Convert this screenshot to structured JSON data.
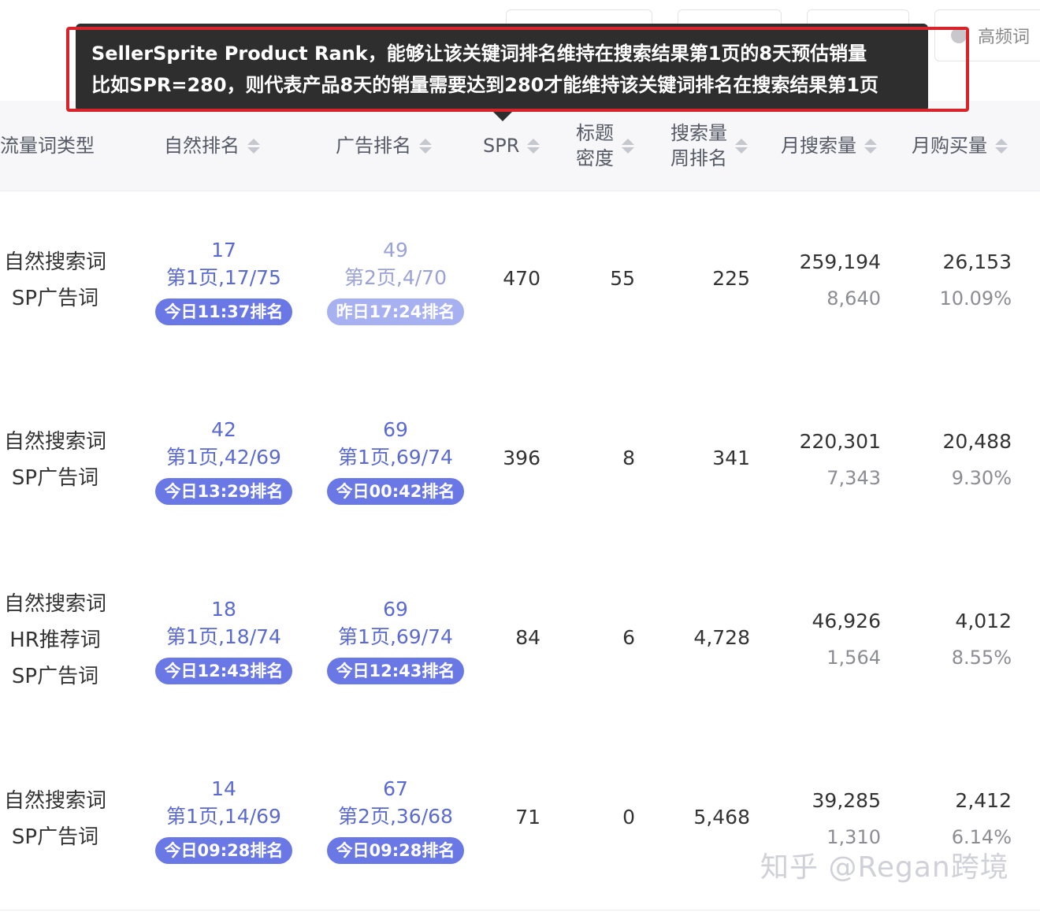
{
  "toolbar": {
    "buttons": [
      "",
      "",
      "",
      "高频词"
    ]
  },
  "tooltip": {
    "line1": "SellerSprite Product Rank，能够让该关键词排名维持在搜索结果第1页的8天预估销量",
    "line2": "比如SPR=280，则代表产品8天的销量需要达到280才能维持该关键词排名在搜索结果第1页"
  },
  "table": {
    "headers": {
      "traffic_type": "流量词类型",
      "natural_rank": "自然排名",
      "ad_rank": "广告排名",
      "spr": "SPR",
      "title_density_l1": "标题",
      "title_density_l2": "密度",
      "search_week_rank_l1": "搜索量",
      "search_week_rank_l2": "周排名",
      "monthly_search": "月搜索量",
      "monthly_purchase": "月购买量"
    },
    "rows": [
      {
        "types": [
          "自然搜索词",
          "SP广告词"
        ],
        "natural": {
          "num": "17",
          "page": "第1页,17/75",
          "time": "今日11:37排名"
        },
        "ad": {
          "num": "49",
          "page": "第2页,4/70",
          "time": "昨日17:24排名"
        },
        "spr": "470",
        "density": "55",
        "week_rank": "225",
        "monthly_search": "259,194",
        "daily_search": "8,640",
        "monthly_purchase": "26,153",
        "purchase_rate": "10.09%"
      },
      {
        "types": [
          "自然搜索词",
          "SP广告词"
        ],
        "natural": {
          "num": "42",
          "page": "第1页,42/69",
          "time": "今日13:29排名"
        },
        "ad": {
          "num": "69",
          "page": "第1页,69/74",
          "time": "今日00:42排名"
        },
        "spr": "396",
        "density": "8",
        "week_rank": "341",
        "monthly_search": "220,301",
        "daily_search": "7,343",
        "monthly_purchase": "20,488",
        "purchase_rate": "9.30%"
      },
      {
        "types": [
          "自然搜索词",
          "HR推荐词",
          "SP广告词"
        ],
        "natural": {
          "num": "18",
          "page": "第1页,18/74",
          "time": "今日12:43排名"
        },
        "ad": {
          "num": "69",
          "page": "第1页,69/74",
          "time": "今日12:43排名"
        },
        "spr": "84",
        "density": "6",
        "week_rank": "4,728",
        "monthly_search": "46,926",
        "daily_search": "1,564",
        "monthly_purchase": "4,012",
        "purchase_rate": "8.55%"
      },
      {
        "types": [
          "自然搜索词",
          "SP广告词"
        ],
        "natural": {
          "num": "14",
          "page": "第1页,14/69",
          "time": "今日09:28排名"
        },
        "ad": {
          "num": "67",
          "page": "第2页,36/68",
          "time": "今日09:28排名"
        },
        "spr": "71",
        "density": "0",
        "week_rank": "5,468",
        "monthly_search": "39,285",
        "daily_search": "1,310",
        "monthly_purchase": "2,412",
        "purchase_rate": "6.14%"
      }
    ]
  },
  "watermark": "知乎 @Regan跨境"
}
